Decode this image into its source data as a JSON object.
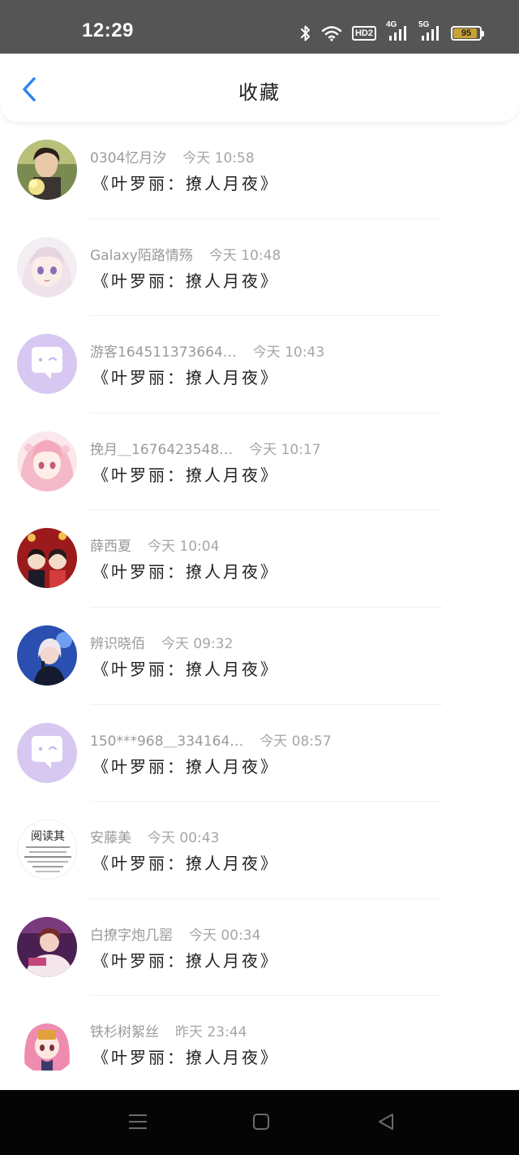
{
  "status_bar": {
    "time": "12:29",
    "hd_label": "HD2",
    "signal1_label": "4G",
    "signal2_label": "5G",
    "battery_level": "95",
    "icons": [
      "bluetooth-icon",
      "wifi-icon",
      "hd-icon",
      "signal-4g-icon",
      "signal-5g-icon",
      "battery-icon"
    ]
  },
  "header": {
    "title": "收藏",
    "back_icon": "chevron-left-icon",
    "accent_color": "#2e86f0"
  },
  "favorites": [
    {
      "name": "0304忆月汐",
      "time": "今天  10:58",
      "title": "《叶罗丽：撩人月夜》",
      "avatar": "photo"
    },
    {
      "name": "Galaxy陌路情殇",
      "time": "今天  10:48",
      "title": "《叶罗丽：撩人月夜》",
      "avatar": "anime"
    },
    {
      "name": "游客164511373664…",
      "time": "今天  10:43",
      "title": "《叶罗丽：撩人月夜》",
      "avatar": "default"
    },
    {
      "name": "挽月＿1676423548…",
      "time": "今天  10:17",
      "title": "《叶罗丽：撩人月夜》",
      "avatar": "anime-pink"
    },
    {
      "name": "薛西夏",
      "time": "今天  10:04",
      "title": "《叶罗丽：撩人月夜》",
      "avatar": "family"
    },
    {
      "name": "辨识晓佰",
      "time": "今天  09:32",
      "title": "《叶罗丽：撩人月夜》",
      "avatar": "singer"
    },
    {
      "name": "150***968＿334164…",
      "time": "今天  08:57",
      "title": "《叶罗丽：撩人月夜》",
      "avatar": "default"
    },
    {
      "name": "安藤美",
      "time": "今天  00:43",
      "title": "《叶罗丽：撩人月夜》",
      "avatar": "text"
    },
    {
      "name": "白撩字炮几罂",
      "time": "今天  00:34",
      "title": "《叶罗丽：撩人月夜》",
      "avatar": "portrait"
    },
    {
      "name": "铁杉树絮丝",
      "time": "昨天  23:44",
      "title": "《叶罗丽：撩人月夜》",
      "avatar": "chibi"
    }
  ],
  "avatar_text": "阅读其",
  "nav_bar": {
    "icons": [
      "menu-icon",
      "home-icon",
      "back-icon"
    ]
  }
}
